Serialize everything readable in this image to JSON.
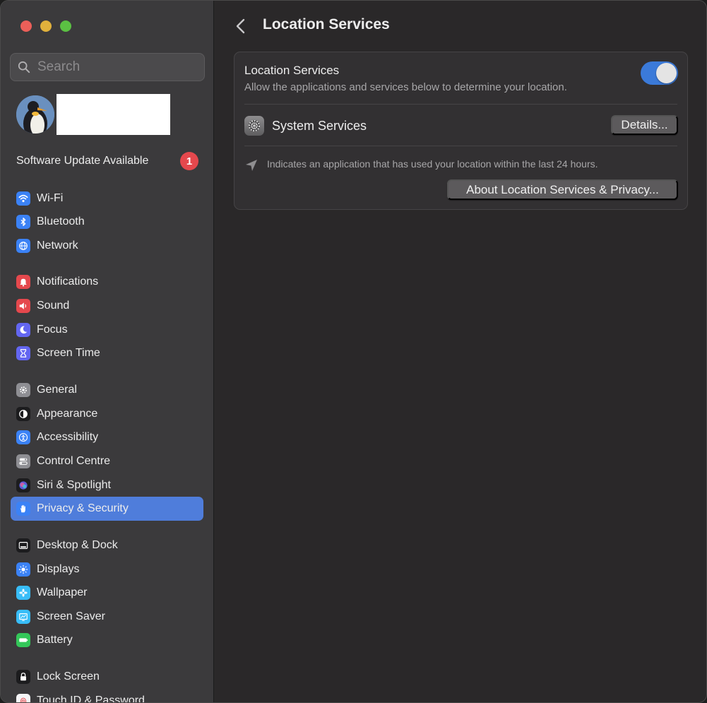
{
  "window": {
    "traffic_lights": [
      "close",
      "minimize",
      "zoom"
    ]
  },
  "sidebar": {
    "search": {
      "placeholder": "Search",
      "value": ""
    },
    "update": {
      "label": "Software Update Available",
      "count": "1"
    },
    "items": [
      {
        "label": "Wi-Fi",
        "icon": "wifi-icon",
        "color": "#3b82f6"
      },
      {
        "label": "Bluetooth",
        "icon": "bluetooth-icon",
        "color": "#3b82f6"
      },
      {
        "label": "Network",
        "icon": "globe-icon",
        "color": "#3b82f6"
      },
      {
        "label": "Notifications",
        "icon": "bell-icon",
        "color": "#e5484d"
      },
      {
        "label": "Sound",
        "icon": "speaker-icon",
        "color": "#e5484d"
      },
      {
        "label": "Focus",
        "icon": "moon-icon",
        "color": "#6366f1"
      },
      {
        "label": "Screen Time",
        "icon": "hourglass-icon",
        "color": "#6366f1"
      },
      {
        "label": "General",
        "icon": "gear-icon",
        "color": "#8e8e93"
      },
      {
        "label": "Appearance",
        "icon": "appearance-icon",
        "color": "#1c1c1e"
      },
      {
        "label": "Accessibility",
        "icon": "accessibility-icon",
        "color": "#3b82f6"
      },
      {
        "label": "Control Centre",
        "icon": "switches-icon",
        "color": "#8e8e93"
      },
      {
        "label": "Siri & Spotlight",
        "icon": "siri-icon",
        "color": "#1c1c1e"
      },
      {
        "label": "Privacy & Security",
        "icon": "hand-icon",
        "color": "#3b82f6",
        "selected": true
      },
      {
        "label": "Desktop & Dock",
        "icon": "dock-icon",
        "color": "#1c1c1e"
      },
      {
        "label": "Displays",
        "icon": "sun-icon",
        "color": "#3b82f6"
      },
      {
        "label": "Wallpaper",
        "icon": "flower-icon",
        "color": "#38bdf8"
      },
      {
        "label": "Screen Saver",
        "icon": "screensaver-icon",
        "color": "#38bdf8"
      },
      {
        "label": "Battery",
        "icon": "battery-icon",
        "color": "#34c759"
      },
      {
        "label": "Lock Screen",
        "icon": "lock-icon",
        "color": "#1c1c1e"
      },
      {
        "label": "Touch ID & Password",
        "icon": "fingerprint-icon",
        "color": "#e5484d"
      }
    ]
  },
  "main": {
    "title": "Location Services",
    "location": {
      "title": "Location Services",
      "description": "Allow the applications and services below to determine your location.",
      "enabled": true
    },
    "system_services": {
      "label": "System Services",
      "button": "Details..."
    },
    "note": "Indicates an application that has used your location within the last 24 hours.",
    "about_button": "About Location Services & Privacy..."
  }
}
